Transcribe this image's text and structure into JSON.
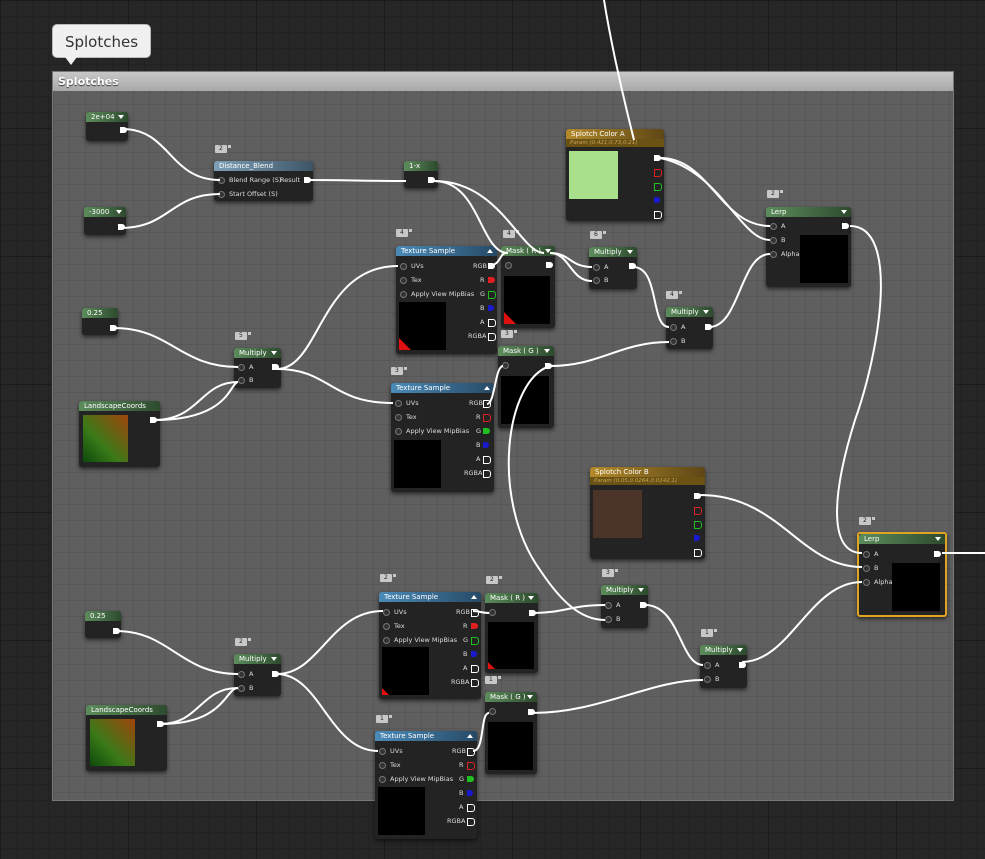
{
  "comment": {
    "bubble": "Splotches",
    "header": "Splotches"
  },
  "constants": {
    "c1": "2e+04",
    "c2": "-3000",
    "c3": "0.25",
    "c4": "1-x",
    "c5": "0.25"
  },
  "labels": {
    "distance_blend": "Distance_Blend",
    "blend_range": "Blend Range (S)",
    "start_offset": "Start Offset (S)",
    "result": "Result",
    "texture_sample": "Texture Sample",
    "uvs": "UVs",
    "tex": "Tex",
    "apply_view_mipbias": "Apply View MipBias",
    "rgb": "RGB",
    "r": "R",
    "g": "G",
    "b": "B",
    "a": "A",
    "rgba": "RGBA",
    "mask_r": "Mask ( R )",
    "mask_g": "Mask ( G )",
    "multiply": "Multiply",
    "lerp": "Lerp",
    "alpha": "Alpha",
    "landscape_coords": "LandscapeCoords",
    "splotch_color_a": "Splotch Color A",
    "splotch_color_a_param": "Param (0.421,0.73,0.21)",
    "splotch_color_b": "Splotch Color B",
    "splotch_color_b_param": "Param (0.05,0.0264,0.0142,1)"
  },
  "badges": {
    "b2": "2",
    "b3": "3",
    "b4": "4",
    "b5": "5",
    "b6": "6",
    "b1": "1"
  },
  "colors": {
    "swatch_a": "#a8e08c",
    "swatch_b": "#4b3528",
    "wire": "#ffffff",
    "selection": "#e0a424",
    "graph_background": "#262626",
    "comment_background": "#5f5f5f"
  }
}
